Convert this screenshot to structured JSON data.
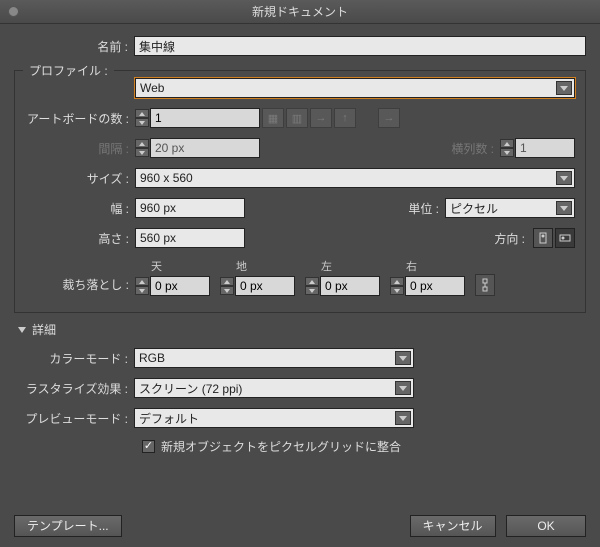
{
  "title": "新規ドキュメント",
  "labels": {
    "name": "名前",
    "profile": "プロファイル",
    "artboards": "アートボードの数",
    "spacing": "間隔",
    "columns": "横列数",
    "size": "サイズ",
    "width": "幅",
    "height": "高さ",
    "units": "単位",
    "orientation": "方向",
    "bleed": "裁ち落とし",
    "top": "天",
    "bottom": "地",
    "left": "左",
    "right": "右",
    "advanced": "詳細",
    "colorMode": "カラーモード",
    "raster": "ラスタライズ効果",
    "preview": "プレビューモード",
    "alignGrid": "新規オブジェクトをピクセルグリッドに整合"
  },
  "values": {
    "name": "集中線",
    "profile": "Web",
    "artboards": "1",
    "spacing": "20 px",
    "columns": "1",
    "size": "960 x 560",
    "width": "960 px",
    "height": "560 px",
    "units": "ピクセル",
    "bleedTop": "0 px",
    "bleedBottom": "0 px",
    "bleedLeft": "0 px",
    "bleedRight": "0 px",
    "colorMode": "RGB",
    "raster": "スクリーン (72 ppi)",
    "preview": "デフォルト",
    "alignGridChecked": "✓"
  },
  "buttons": {
    "templates": "テンプレート...",
    "cancel": "キャンセル",
    "ok": "OK"
  }
}
